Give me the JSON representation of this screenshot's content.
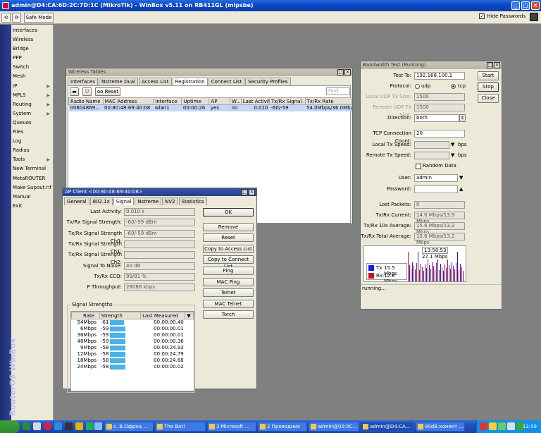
{
  "app": {
    "title": "admin@D4:CA:6D:2C:7D:1C (MikroTik) - WinBox v5.11 on RB411GL (mipsbe)",
    "hide_passwords": "Hide Passwords",
    "safe_mode": "Safe Mode",
    "back": "⟲",
    "fwd": "⟳",
    "side_label": "RouterOS WinBox"
  },
  "sidebar": {
    "items": [
      {
        "label": "Interfaces",
        "sub": false
      },
      {
        "label": "Wireless",
        "sub": false
      },
      {
        "label": "Bridge",
        "sub": false
      },
      {
        "label": "PPP",
        "sub": false
      },
      {
        "label": "Switch",
        "sub": false
      },
      {
        "label": "Mesh",
        "sub": false
      },
      {
        "label": "IP",
        "sub": true
      },
      {
        "label": "MPLS",
        "sub": true
      },
      {
        "label": "Routing",
        "sub": true
      },
      {
        "label": "System",
        "sub": true
      },
      {
        "label": "Queues",
        "sub": false
      },
      {
        "label": "Files",
        "sub": false
      },
      {
        "label": "Log",
        "sub": false
      },
      {
        "label": "Radius",
        "sub": false
      },
      {
        "label": "Tools",
        "sub": true
      },
      {
        "label": "New Terminal",
        "sub": false
      },
      {
        "label": "MetaROUTER",
        "sub": false
      },
      {
        "label": "Make Supout.rif",
        "sub": false
      },
      {
        "label": "Manual",
        "sub": false
      },
      {
        "label": "Exit",
        "sub": false
      }
    ]
  },
  "wireless": {
    "title": "Wireless Tables",
    "tabs": [
      "Interfaces",
      "Nstreme Dual",
      "Access List",
      "Registration",
      "Connect List",
      "Security Profiles"
    ],
    "reset": "Reset",
    "find_placeholder": "Find",
    "columns": [
      "Radio Name",
      "MAC Address",
      "Interface",
      "Uptime",
      "AP",
      "W...",
      "Last Activit...",
      "Tx/Rx Signal ...",
      "Tx/Rx Rate"
    ],
    "row": [
      "00804869...",
      "00:80:48:69:40:08",
      "wlan1",
      "00:00:26",
      "yes",
      "no",
      "0.010",
      "-60/-59",
      "54.0Mbps/36.0Mbps"
    ]
  },
  "ap": {
    "title": "AP Client <00:80:48:69:40:08>",
    "tabs": [
      "General",
      "802.1x",
      "Signal",
      "Nstreme",
      "NV2",
      "Statistics"
    ],
    "fields": [
      {
        "label": "Last Activity:",
        "value": "0.010 s"
      },
      {
        "label": "Tx/Rx Signal Strength:",
        "value": "-60/-59 dBm"
      },
      {
        "label": "Tx/Rx Signal Strength Ch0:",
        "value": "-60/-59 dBm"
      },
      {
        "label": "Tx/Rx Signal Strength Ch1:",
        "value": ""
      },
      {
        "label": "Tx/Rx Signal Strength Ch2:",
        "value": ""
      },
      {
        "label": "Signal To Noise:",
        "value": "40 dB"
      },
      {
        "label": "Tx/Rx CCQ:",
        "value": "99/81 %"
      },
      {
        "label": "P Throughput:",
        "value": "28088 kbps"
      }
    ],
    "group": "Signal Strengths",
    "cols": [
      "Rate",
      "Strength",
      "Last Measured"
    ],
    "rates": [
      {
        "rate": "54Mbps",
        "strength": "-61",
        "time": "00:00:00.40",
        "level": 0.55
      },
      {
        "rate": "6Mbps",
        "strength": "-59",
        "time": "00:00:00.01",
        "level": 0.6
      },
      {
        "rate": "36Mbps",
        "strength": "-59",
        "time": "00:00:00.01",
        "level": 0.6
      },
      {
        "rate": "48Mbps",
        "strength": "-59",
        "time": "00:00:00.36",
        "level": 0.6
      },
      {
        "rate": "9Mbps",
        "strength": "-58",
        "time": "00:00:24.93",
        "level": 0.62
      },
      {
        "rate": "12Mbps",
        "strength": "-58",
        "time": "00:00:24.79",
        "level": 0.62
      },
      {
        "rate": "18Mbps",
        "strength": "-58",
        "time": "00:00:24.68",
        "level": 0.62
      },
      {
        "rate": "24Mbps",
        "strength": "-58",
        "time": "00:00:00.02",
        "level": 0.62
      }
    ],
    "buttons": [
      "OK",
      "Remove",
      "Reset",
      "Copy to Access List",
      "Copy to Connect List",
      "Ping",
      "MAC Ping",
      "Telnet",
      "MAC Telnet",
      "Torch"
    ]
  },
  "bw": {
    "title": "Bandwidth Test (Running)",
    "buttons": [
      "Start",
      "Stop",
      "Close"
    ],
    "test_to_label": "Test To:",
    "test_to": "192.168.100.1",
    "protocol_label": "Protocol:",
    "udp": "udp",
    "tcp": "tcp",
    "local_udp_label": "Local UDP Tx Size:",
    "local_udp": "1500",
    "remote_udp_label": "Remote UDP Tx Size:",
    "remote_udp": "1500",
    "direction_label": "Direction:",
    "direction": "both",
    "tcp_conn_label": "TCP Connection Count:",
    "tcp_conn": "20",
    "local_speed_label": "Local Tx Speed:",
    "remote_speed_label": "Remote Tx Speed:",
    "bps": "bps",
    "random": "Random Data",
    "user_label": "User:",
    "user": "admin",
    "password_label": "Password:",
    "lost_label": "Lost Packets:",
    "lost": "0",
    "current_label": "Tx/Rx Current:",
    "current": "14.6 Mbps/13.9 Mbps",
    "avg10_label": "Tx/Rx 10s Average:",
    "avg10": "15.6 Mbps/13.2 Mbps",
    "total_label": "Tx/Rx Total Average:",
    "total": "15.6 Mbps/13.2 Mbps",
    "graph_time": "13:58:53",
    "graph_value": "27.1 Mbps",
    "legend_tx": "Tx:",
    "legend_tx_val": "15.5 Mbps",
    "legend_rx": "Rx:",
    "legend_rx_val": "12.8 Mbps",
    "tx_color": "#1a1ae0",
    "rx_color": "#c81414",
    "status": "running..."
  },
  "taskbar": {
    "tasks": [
      "с. В.Офрна ...",
      "The Bat!",
      "3 Microsoft ...",
      "2 Проводник",
      "admin@00:0C...",
      "admin@D4:CA...",
      "90dB конект ..."
    ],
    "clock": "13:59"
  }
}
